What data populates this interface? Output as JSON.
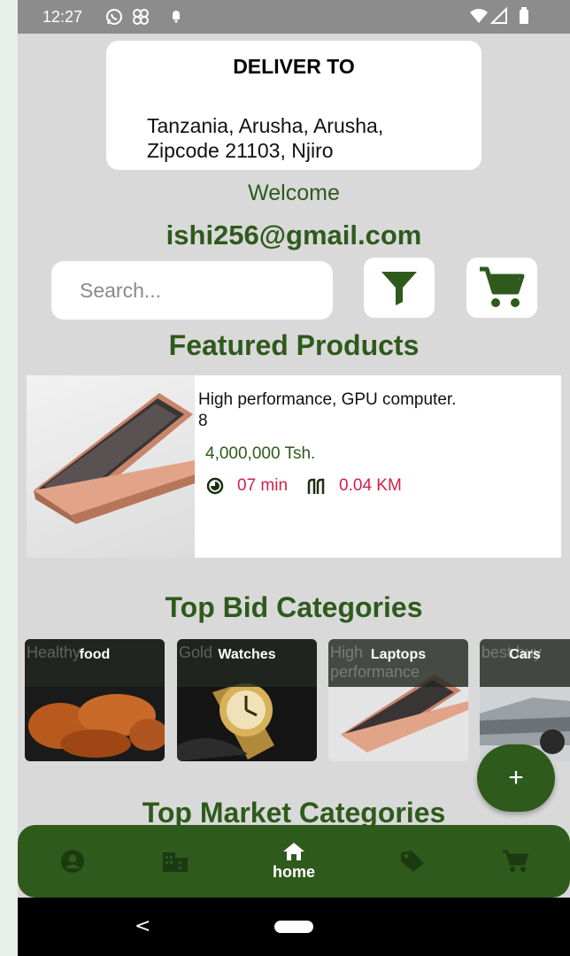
{
  "status_bar": {
    "time": "12:27"
  },
  "deliver": {
    "title": "DELIVER TO",
    "address_line1": "Tanzania, Arusha, Arusha,",
    "address_line2": "Zipcode 21103, Njiro"
  },
  "welcome": "Welcome",
  "email": "ishi256@gmail.com",
  "search": {
    "placeholder": "Search..."
  },
  "featured": {
    "title": "Featured Products",
    "product": {
      "name": "High performance, GPU computer.",
      "qty": "8",
      "price": "4,000,000 Tsh.",
      "time": "07 min",
      "distance": "0.04 KM"
    }
  },
  "top_bid": {
    "title": "Top Bid Categories",
    "categories": [
      {
        "label": "food",
        "ghost": "Healthy"
      },
      {
        "label": "Watches",
        "ghost": "Gold"
      },
      {
        "label": "Laptops",
        "ghost": "High performance"
      },
      {
        "label": "Cars",
        "ghost": "best buy"
      }
    ]
  },
  "top_market": {
    "title": "Top Market Categories"
  },
  "fab": {
    "label": "+"
  },
  "bottom_nav": {
    "items": [
      {
        "icon": "account-icon"
      },
      {
        "icon": "business-icon"
      },
      {
        "icon": "home-icon",
        "label": "home"
      },
      {
        "icon": "tag-icon"
      },
      {
        "icon": "cart-icon"
      }
    ]
  },
  "system_nav": {
    "back": "<"
  },
  "colors": {
    "primary": "#2e5a1c",
    "accent_red": "#d4204a",
    "background": "#d9d9d9"
  }
}
